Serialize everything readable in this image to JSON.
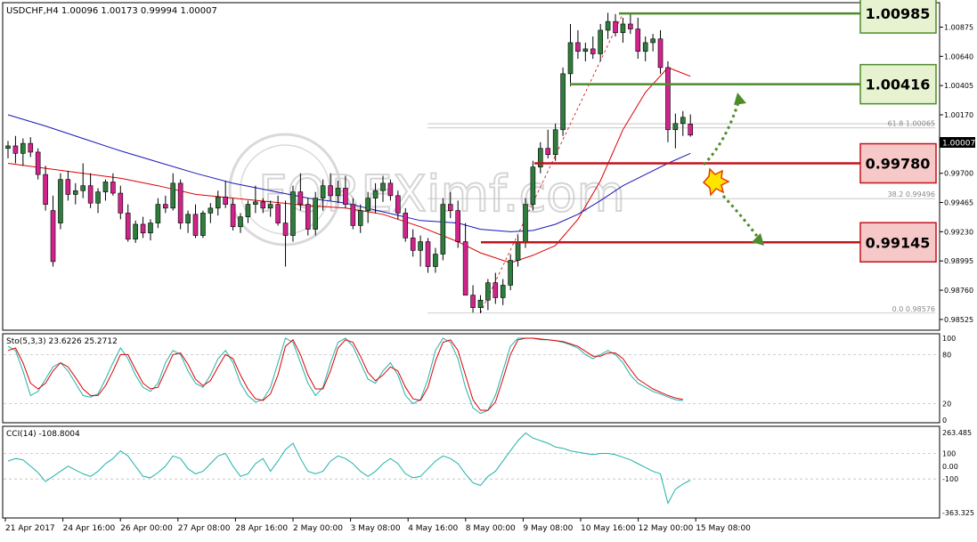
{
  "chart_data": {
    "type": "candlestick",
    "symbol_header": "USDCHF,H4  1.00096 1.00173 0.99994 1.00007",
    "watermark": "FOREXimf.com",
    "price_axis": {
      "min": 0.9846,
      "max": 1.0105,
      "ticks": [
        "1.00875",
        "1.00640",
        "1.00405",
        "1.00170",
        "0.99935",
        "0.99700",
        "0.99465",
        "0.99230",
        "0.98995",
        "0.98760",
        "0.98525"
      ],
      "current": "1.00007"
    },
    "x_labels": [
      "21 Apr 2017",
      "24 Apr 16:00",
      "26 Apr 00:00",
      "27 Apr 08:00",
      "28 Apr 16:00",
      "2 May 00:00",
      "3 May 08:00",
      "4 May 16:00",
      "8 May 00:00",
      "9 May 08:00",
      "10 May 16:00",
      "12 May 00:00",
      "15 May 08:00"
    ],
    "fib_labels": {
      "f618": "61.8  1.00065",
      "f382": "38.2  0.99496",
      "f0": "0.0  0.98576"
    },
    "levels": [
      {
        "label": "1.00985",
        "price": 1.00985,
        "kind": "resistance"
      },
      {
        "label": "1.00416",
        "price": 1.00416,
        "kind": "resistance"
      },
      {
        "label": "0.99780",
        "price": 0.9978,
        "kind": "support"
      },
      {
        "label": "0.99145",
        "price": 0.99145,
        "kind": "support"
      }
    ],
    "candles": [
      [
        0.999,
        0.9996,
        0.9982,
        0.9992
      ],
      [
        0.9992,
        1.0,
        0.9978,
        0.9986
      ],
      [
        0.9986,
        0.9998,
        0.9976,
        0.9994
      ],
      [
        0.9994,
        0.9999,
        0.9983,
        0.9987
      ],
      [
        0.9987,
        0.999,
        0.9965,
        0.9969
      ],
      [
        0.9969,
        0.9976,
        0.994,
        0.9945
      ],
      [
        0.994,
        0.9952,
        0.9895,
        0.9899
      ],
      [
        0.993,
        0.997,
        0.9925,
        0.9965
      ],
      [
        0.9965,
        0.9972,
        0.9948,
        0.9953
      ],
      [
        0.9953,
        0.9962,
        0.9945,
        0.9956
      ],
      [
        0.9956,
        0.9978,
        0.995,
        0.996
      ],
      [
        0.996,
        0.997,
        0.9942,
        0.9946
      ],
      [
        0.9946,
        0.9958,
        0.9938,
        0.9955
      ],
      [
        0.9955,
        0.9965,
        0.9948,
        0.9963
      ],
      [
        0.9963,
        0.997,
        0.9952,
        0.9954
      ],
      [
        0.9954,
        0.996,
        0.9933,
        0.9938
      ],
      [
        0.9938,
        0.9945,
        0.9915,
        0.9917
      ],
      [
        0.9917,
        0.9932,
        0.9914,
        0.9929
      ],
      [
        0.9929,
        0.9935,
        0.9918,
        0.9922
      ],
      [
        0.9922,
        0.9933,
        0.9916,
        0.993
      ],
      [
        0.993,
        0.995,
        0.9926,
        0.9945
      ],
      [
        0.9945,
        0.9952,
        0.9938,
        0.9942
      ],
      [
        0.9942,
        0.997,
        0.994,
        0.9962
      ],
      [
        0.9962,
        0.9965,
        0.9925,
        0.993
      ],
      [
        0.993,
        0.994,
        0.9922,
        0.9937
      ],
      [
        0.9937,
        0.9945,
        0.9918,
        0.992
      ],
      [
        0.992,
        0.994,
        0.9918,
        0.9938
      ],
      [
        0.9938,
        0.9946,
        0.993,
        0.9942
      ],
      [
        0.9942,
        0.9956,
        0.9936,
        0.9951
      ],
      [
        0.9951,
        0.9964,
        0.9942,
        0.9945
      ],
      [
        0.9945,
        0.995,
        0.9924,
        0.9927
      ],
      [
        0.9927,
        0.9938,
        0.9922,
        0.9935
      ],
      [
        0.9935,
        0.9948,
        0.993,
        0.9945
      ],
      [
        0.9945,
        0.996,
        0.9938,
        0.9947
      ],
      [
        0.9947,
        0.995,
        0.9938,
        0.9942
      ],
      [
        0.9942,
        0.9948,
        0.9935,
        0.9945
      ],
      [
        0.9945,
        0.9952,
        0.9928,
        0.993
      ],
      [
        0.993,
        0.9948,
        0.9895,
        0.992
      ],
      [
        0.992,
        0.996,
        0.9915,
        0.9955
      ],
      [
        0.9955,
        0.997,
        0.994,
        0.9945
      ],
      [
        0.9945,
        0.995,
        0.992,
        0.9925
      ],
      [
        0.9925,
        0.9955,
        0.992,
        0.995
      ],
      [
        0.995,
        0.9965,
        0.994,
        0.996
      ],
      [
        0.996,
        0.997,
        0.9948,
        0.9952
      ],
      [
        0.9952,
        0.9964,
        0.9946,
        0.9958
      ],
      [
        0.9958,
        0.9968,
        0.9942,
        0.9945
      ],
      [
        0.9945,
        0.995,
        0.9925,
        0.9928
      ],
      [
        0.9928,
        0.9945,
        0.9922,
        0.994
      ],
      [
        0.994,
        0.9955,
        0.993,
        0.995
      ],
      [
        0.995,
        0.9962,
        0.9938,
        0.9956
      ],
      [
        0.9956,
        0.9968,
        0.9947,
        0.9962
      ],
      [
        0.9962,
        0.9965,
        0.9948,
        0.9952
      ],
      [
        0.9952,
        0.9956,
        0.9933,
        0.9938
      ],
      [
        0.9938,
        0.9942,
        0.9915,
        0.9918
      ],
      [
        0.9918,
        0.9925,
        0.9903,
        0.9908
      ],
      [
        0.9908,
        0.992,
        0.9895,
        0.9915
      ],
      [
        0.9915,
        0.9918,
        0.989,
        0.9895
      ],
      [
        0.9895,
        0.991,
        0.989,
        0.9905
      ],
      [
        0.9905,
        0.995,
        0.99,
        0.9945
      ],
      [
        0.9945,
        0.9955,
        0.9934,
        0.994
      ],
      [
        0.994,
        0.9948,
        0.991,
        0.9915
      ],
      [
        0.9915,
        0.993,
        0.989,
        0.9872
      ],
      [
        0.9872,
        0.988,
        0.9858,
        0.9862
      ],
      [
        0.9862,
        0.9872,
        0.98576,
        0.9868
      ],
      [
        0.9868,
        0.9885,
        0.986,
        0.9882
      ],
      [
        0.9882,
        0.989,
        0.9865,
        0.987
      ],
      [
        0.987,
        0.9885,
        0.9864,
        0.988
      ],
      [
        0.988,
        0.9905,
        0.9876,
        0.99
      ],
      [
        0.99,
        0.992,
        0.9895,
        0.9915
      ],
      [
        0.9915,
        0.995,
        0.991,
        0.9945
      ],
      [
        0.9945,
        0.998,
        0.994,
        0.9975
      ],
      [
        0.9975,
        0.9995,
        0.997,
        0.999
      ],
      [
        0.999,
        1.0005,
        0.9982,
        0.9985
      ],
      [
        0.9985,
        1.001,
        0.998,
        1.0005
      ],
      [
        1.0005,
        1.0055,
        1.0,
        1.005
      ],
      [
        1.005,
        1.009,
        1.004,
        1.0075
      ],
      [
        1.0075,
        1.0085,
        1.0062,
        1.0068
      ],
      [
        1.0068,
        1.0075,
        1.006,
        1.007
      ],
      [
        1.007,
        1.008,
        1.0062,
        1.0066
      ],
      [
        1.0066,
        1.009,
        1.006,
        1.0085
      ],
      [
        1.0085,
        1.0099,
        1.0078,
        1.0092
      ],
      [
        1.0092,
        1.0098,
        1.008,
        1.0083
      ],
      [
        1.0083,
        1.0095,
        1.0075,
        1.009
      ],
      [
        1.009,
        1.00985,
        1.0082,
        1.0086
      ],
      [
        1.0086,
        1.0095,
        1.0062,
        1.0068
      ],
      [
        1.0068,
        1.008,
        1.006,
        1.0075
      ],
      [
        1.0075,
        1.0082,
        1.0068,
        1.0078
      ],
      [
        1.0078,
        1.0085,
        1.005,
        1.0055
      ],
      [
        1.0055,
        1.006,
        0.9995,
        1.0005
      ],
      [
        1.0005,
        1.0018,
        0.999,
        1.001
      ],
      [
        1.001,
        1.002,
        1.0,
        1.0015
      ],
      [
        1.00096,
        1.00173,
        0.99994,
        1.00007
      ]
    ],
    "series": [
      {
        "name": "",
        "color": "#dd0000",
        "points": [
          [
            0,
            0.9978
          ],
          [
            5,
            0.9974
          ],
          [
            10,
            0.997
          ],
          [
            15,
            0.9966
          ],
          [
            20,
            0.996
          ],
          [
            25,
            0.9953
          ],
          [
            30,
            0.995
          ],
          [
            35,
            0.9947
          ],
          [
            40,
            0.9944
          ],
          [
            45,
            0.9942
          ],
          [
            50,
            0.9937
          ],
          [
            55,
            0.9927
          ],
          [
            60,
            0.9915
          ],
          [
            63,
            0.9906
          ],
          [
            67,
            0.9898
          ],
          [
            70,
            0.9904
          ],
          [
            73,
            0.9912
          ],
          [
            76,
            0.9933
          ],
          [
            79,
            0.9964
          ],
          [
            82,
            1.0005
          ],
          [
            85,
            1.0035
          ],
          [
            88,
            1.0055
          ],
          [
            91,
            1.0048
          ]
        ]
      },
      {
        "name": "",
        "color": "#1616b8",
        "points": [
          [
            0,
            1.0017
          ],
          [
            5,
            1.0008
          ],
          [
            10,
            0.9998
          ],
          [
            15,
            0.9988
          ],
          [
            20,
            0.9979
          ],
          [
            25,
            0.997
          ],
          [
            30,
            0.9962
          ],
          [
            35,
            0.9956
          ],
          [
            40,
            0.995
          ],
          [
            45,
            0.9946
          ],
          [
            50,
            0.9939
          ],
          [
            55,
            0.9932
          ],
          [
            60,
            0.993
          ],
          [
            63,
            0.9925
          ],
          [
            67,
            0.9923
          ],
          [
            70,
            0.9924
          ],
          [
            73,
            0.9929
          ],
          [
            76,
            0.9937
          ],
          [
            79,
            0.9948
          ],
          [
            82,
            0.996
          ],
          [
            85,
            0.9969
          ],
          [
            88,
            0.9978
          ],
          [
            91,
            0.9986
          ]
        ]
      }
    ],
    "stochastic": {
      "label": "Sto(5,3,3) 23.6226 25.2712",
      "ticks": [
        "100",
        "80",
        "20",
        "0"
      ],
      "main": [
        90,
        85,
        60,
        30,
        35,
        50,
        65,
        70,
        60,
        45,
        30,
        28,
        32,
        50,
        70,
        88,
        75,
        55,
        40,
        35,
        45,
        70,
        85,
        80,
        60,
        45,
        40,
        55,
        75,
        85,
        70,
        45,
        30,
        22,
        25,
        40,
        70,
        100,
        95,
        70,
        45,
        30,
        40,
        70,
        95,
        100,
        90,
        70,
        50,
        45,
        60,
        70,
        55,
        30,
        20,
        25,
        50,
        85,
        100,
        95,
        75,
        40,
        15,
        8,
        12,
        30,
        60,
        90,
        100,
        100,
        100,
        98,
        98,
        97,
        95,
        92,
        88,
        80,
        75,
        80,
        85,
        80,
        70,
        55,
        45,
        40,
        35,
        32,
        28,
        25,
        23.6
      ],
      "signal": [
        85,
        88,
        70,
        45,
        38,
        45,
        60,
        70,
        65,
        52,
        38,
        30,
        30,
        42,
        60,
        80,
        80,
        62,
        45,
        38,
        40,
        60,
        80,
        82,
        68,
        50,
        42,
        48,
        65,
        80,
        75,
        55,
        38,
        26,
        24,
        32,
        55,
        90,
        98,
        80,
        55,
        38,
        38,
        60,
        88,
        98,
        95,
        78,
        58,
        48,
        55,
        65,
        60,
        40,
        26,
        24,
        40,
        72,
        95,
        98,
        85,
        55,
        25,
        12,
        12,
        22,
        50,
        80,
        98,
        100,
        100,
        99,
        98,
        97,
        96,
        93,
        90,
        84,
        78,
        78,
        82,
        82,
        75,
        62,
        50,
        44,
        38,
        34,
        30,
        27,
        25.3
      ]
    },
    "cci": {
      "label": "CCI(14) -108.8004",
      "ticks": [
        "263.485",
        "100",
        "0.00",
        "-100",
        "-363.325"
      ],
      "values": [
        40,
        60,
        50,
        0,
        -50,
        -120,
        -80,
        -40,
        0,
        -30,
        -60,
        -80,
        -40,
        20,
        60,
        120,
        80,
        0,
        -80,
        -90,
        -50,
        0,
        80,
        60,
        -20,
        -60,
        -40,
        20,
        80,
        100,
        0,
        -80,
        -60,
        20,
        60,
        -40,
        40,
        130,
        180,
        60,
        -40,
        -60,
        -40,
        40,
        80,
        60,
        20,
        -40,
        -80,
        -40,
        20,
        60,
        20,
        -60,
        -90,
        -80,
        -20,
        40,
        80,
        60,
        20,
        -60,
        -130,
        -150,
        -80,
        -40,
        40,
        120,
        200,
        260,
        220,
        200,
        180,
        150,
        140,
        120,
        110,
        100,
        90,
        100,
        100,
        90,
        70,
        50,
        20,
        -10,
        -40,
        -60,
        -290,
        -180,
        -140,
        -109
      ]
    }
  }
}
